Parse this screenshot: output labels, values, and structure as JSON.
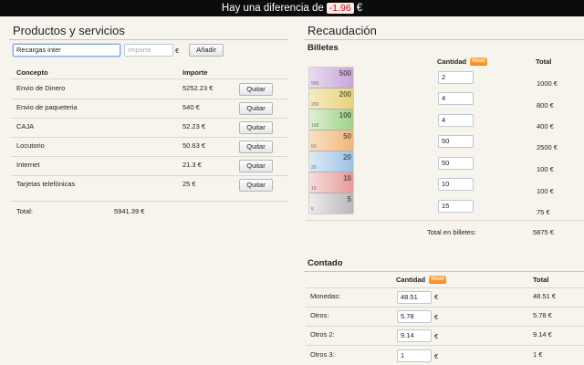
{
  "topbar": {
    "prefix": "Hay una diferencia de",
    "value": "-1.96",
    "suffix": "€"
  },
  "productos": {
    "title": "Productos y servicios",
    "concepto_input_value": "Recargas inter",
    "importe_placeholder": "Importe",
    "currency": "€",
    "add_label": "Añadir",
    "col_concepto": "Concepto",
    "col_importe": "Importe",
    "rows": [
      {
        "concepto": "Envio de Dinero",
        "importe": "5252.23 €",
        "action": "Quitar"
      },
      {
        "concepto": "Envio de paqueteria",
        "importe": "540 €",
        "action": "Quitar"
      },
      {
        "concepto": "CAJA",
        "importe": "52.23 €",
        "action": "Quitar"
      },
      {
        "concepto": "Locutorio",
        "importe": "50.63 €",
        "action": "Quitar"
      },
      {
        "concepto": "Internet",
        "importe": "21.3 €",
        "action": "Quitar"
      },
      {
        "concepto": "Tarjetas telefónicas",
        "importe": "25 €",
        "action": "Quitar"
      }
    ],
    "total_label": "Total:",
    "total_value": "5941.39 €"
  },
  "recaudacion": {
    "title": "Recaudación",
    "billetes_heading": "Billetes",
    "col_cantidad": "Cantidad",
    "reset_label": "Reset",
    "col_total": "Total",
    "billetes": [
      {
        "denom": "500",
        "cantidad": "2",
        "total": "1000 €",
        "color": "#c9a6d8"
      },
      {
        "denom": "200",
        "cantidad": "4",
        "total": "800 €",
        "color": "#e8d27a"
      },
      {
        "denom": "100",
        "cantidad": "4",
        "total": "400 €",
        "color": "#9fd08a"
      },
      {
        "denom": "50",
        "cantidad": "50",
        "total": "2500 €",
        "color": "#f0b77a"
      },
      {
        "denom": "20",
        "cantidad": "50",
        "total": "100 €",
        "color": "#9cc2e8"
      },
      {
        "denom": "10",
        "cantidad": "10",
        "total": "100 €",
        "color": "#e89a9a"
      },
      {
        "denom": "5",
        "cantidad": "15",
        "total": "75 €",
        "color": "#c4c4c4"
      }
    ],
    "total_billetes_label": "Total en billetes:",
    "total_billetes_value": "5875 €",
    "contado_heading": "Contado",
    "contado": [
      {
        "label": "Monedas:",
        "cantidad": "48.51",
        "total": "48.51 €"
      },
      {
        "label": "Otros:",
        "cantidad": "5.78",
        "total": "5.78 €"
      },
      {
        "label": "Otros 2:",
        "cantidad": "9.14",
        "total": "9.14 €"
      },
      {
        "label": "Otros 3:",
        "cantidad": "1",
        "total": "1 €"
      }
    ],
    "currency": "€"
  }
}
